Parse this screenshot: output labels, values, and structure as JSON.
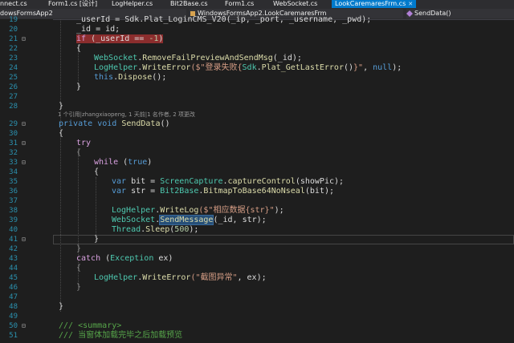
{
  "tabs": [
    {
      "label": "nnect.cs"
    },
    {
      "label": "Form1.cs [设计]"
    },
    {
      "label": "LogHelper.cs"
    },
    {
      "label": "Bit2Base.cs"
    },
    {
      "label": "Form1.cs"
    },
    {
      "label": "WebSocket.cs"
    },
    {
      "label": "LookCaremaresFrm.cs",
      "active": true
    }
  ],
  "navbar": {
    "project": "dowsFormsApp2",
    "class": "WindowsFormsApp2.LookCaremaresFrm",
    "member": "SendData()"
  },
  "line_numbers": [
    "19",
    "20",
    "21",
    "22",
    "23",
    "24",
    "25",
    "26",
    "27",
    "28",
    "29",
    "30",
    "31",
    "32",
    "33",
    "34",
    "35",
    "36",
    "37",
    "38",
    "39",
    "40",
    "41",
    "42",
    "43",
    "44",
    "45",
    "46",
    "47",
    "48",
    "49",
    "50",
    "51"
  ],
  "codelens": "1 个引用|zhangxiaopeng, 1 天前|1 名作者, 2 项更改",
  "code": {
    "l19": "_userId = Sdk.Plat_LoginCMS_V20(_ip, _port, _username, _pwd);",
    "l20": "_id = id;",
    "l21a": "if",
    "l21b": " (_userId == ",
    "l21c": "-1",
    "l23a": "WebSocket",
    "l23b": ".",
    "l23c": "RemoveFailPreviewAndSendMsg",
    "l23d": "(_id);",
    "l24a": "LogHelper",
    "l24b": ".",
    "l24c": "WriteError",
    "l24d": "($\"登录失败",
    "l24e": "{",
    "l24f": "Sdk",
    "l24g": ".",
    "l24h": "Plat_GetLastError",
    "l24i": "()",
    "l24j": "}\"",
    "l24k": ", ",
    "l24l": "null",
    "l24m": ");",
    "l25a": "this",
    "l25b": ".",
    "l25c": "Dispose",
    "l25d": "();",
    "l29a": "private",
    "l29b": "void",
    "l29c": "SendData",
    "l29d": "()",
    "l31": "try",
    "l33a": "while",
    "l33b": " (",
    "l33c": "true",
    "l33d": ")",
    "l35a": "var",
    "l35b": " bit = ",
    "l35c": "ScreenCapture",
    "l35d": ".",
    "l35e": "captureControl",
    "l35f": "(showPic);",
    "l36a": "var",
    "l36b": " str = ",
    "l36c": "Bit2Base",
    "l36d": ".",
    "l36e": "BitmapToBase64NoNseal",
    "l36f": "(bit);",
    "l38a": "LogHelper",
    "l38b": ".",
    "l38c": "WriteLog",
    "l38d": "($\"相应数据",
    "l38e": "{str}",
    "l38f": "\"",
    "l38g": ");",
    "l39a": "WebSocket",
    "l39b": ".",
    "l39c": "SendMessage",
    "l39d": "(_id, str);",
    "l40a": "Thread",
    "l40b": ".",
    "l40c": "Sleep",
    "l40d": "(",
    "l40e": "500",
    "l40f": ");",
    "l43a": "catch",
    "l43b": " (",
    "l43c": "Exception",
    "l43d": " ex)",
    "l45a": "LogHelper",
    "l45b": ".",
    "l45c": "WriteError",
    "l45d": "(\"截图异常\"",
    "l45e": ", ex);",
    "l50": "/// <summary>",
    "l51": "/// 当窗体加载完毕之后加载预览"
  }
}
